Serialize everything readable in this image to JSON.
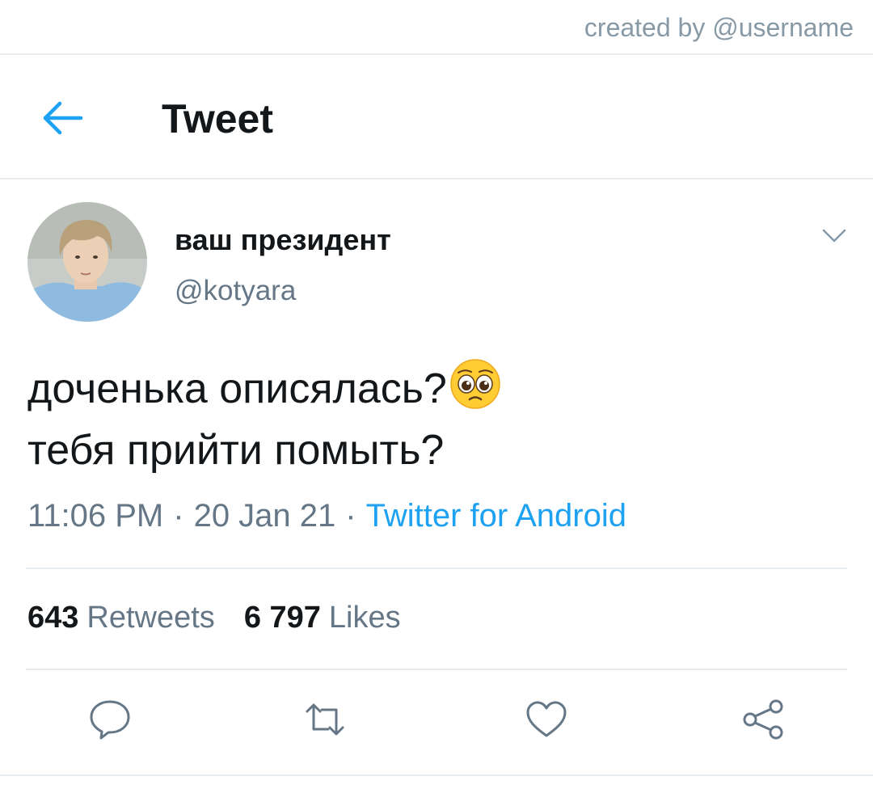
{
  "credit": "created by @username",
  "header": {
    "title": "Tweet"
  },
  "author": {
    "display_name": "ваш президент",
    "handle": "@kotyara"
  },
  "tweet": {
    "line1": "доченька описялась?",
    "line2": "тебя прийти помыть?",
    "emoji": "pleading-face-icon"
  },
  "meta": {
    "time": "11:06 PM",
    "separator": "·",
    "date": "20 Jan 21",
    "source": "Twitter for Android"
  },
  "stats": {
    "retweets_count": "643",
    "retweets_label": "Retweets",
    "likes_count": "6 797",
    "likes_label": "Likes"
  },
  "colors": {
    "accent": "#1da1f2",
    "secondary_text": "#657786",
    "divider": "#e6ecf0"
  }
}
